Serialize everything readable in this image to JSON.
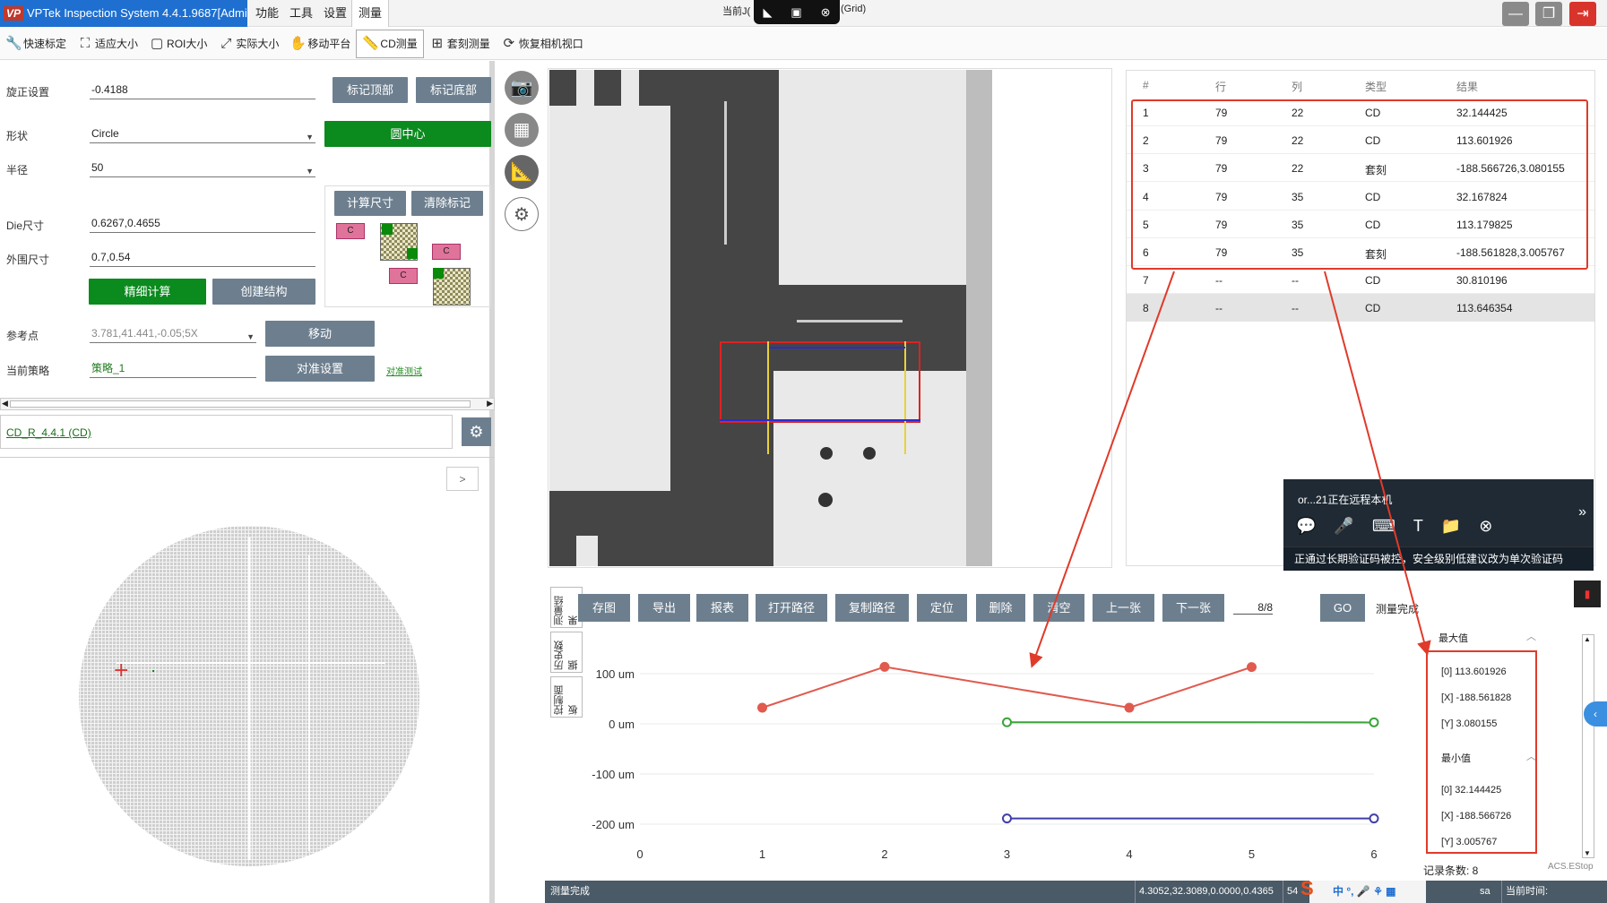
{
  "app": {
    "title": "VPTek Inspection System 4.4.1.9687[Admin]",
    "logo": "VP",
    "menus": [
      "功能",
      "工具",
      "设置",
      "测量"
    ],
    "active_menu": "测量",
    "remote_prefix": "当前J(",
    "remote_grid": "(Grid)"
  },
  "toolbar": [
    {
      "label": "快速标定",
      "icon": "wrench-icon"
    },
    {
      "label": "适应大小",
      "icon": "fit-icon"
    },
    {
      "label": "ROI大小",
      "icon": "roi-icon"
    },
    {
      "label": "实际大小",
      "icon": "expand-icon"
    },
    {
      "label": "移动平台",
      "icon": "hand-icon"
    },
    {
      "label": "CD测量",
      "icon": "ruler-icon"
    },
    {
      "label": "套刻测量",
      "icon": "plus-icon"
    },
    {
      "label": "恢复相机视口",
      "icon": "camera-reset-icon"
    }
  ],
  "left": {
    "rotation_label": "旋正设置",
    "rotation_value": "-0.4188",
    "mark_top": "标记顶部",
    "mark_bottom": "标记底部",
    "shape_label": "形状",
    "shape_value": "Circle",
    "circle_center": "圆中心",
    "radius_label": "半径",
    "radius_value": "50",
    "calc_size": "计算尺寸",
    "clear_mark": "清除标记",
    "tag_c": "C",
    "die_label": "Die尺寸",
    "die_value": "0.6267,0.4655",
    "outer_label": "外围尺寸",
    "outer_value": "0.7,0.54",
    "fine_calc": "精细计算",
    "create_struct": "创建结构",
    "ref_label": "参考点",
    "ref_value": "3.781,41.441,-0.05;5X",
    "move_btn": "移动",
    "strategy_label": "当前策略",
    "strategy_value": "策略_1",
    "align_btn": "对准设置",
    "align_test": "对准测试",
    "recipe_link": "CD_R_4.4.1 (CD)",
    "expand_btn": ">"
  },
  "results": {
    "headers": [
      "#",
      "行",
      "列",
      "类型",
      "结果"
    ],
    "rows": [
      [
        "1",
        "79",
        "22",
        "CD",
        "32.144425"
      ],
      [
        "2",
        "79",
        "22",
        "CD",
        "113.601926"
      ],
      [
        "3",
        "79",
        "22",
        "套刻",
        "-188.566726,3.080155"
      ],
      [
        "4",
        "79",
        "35",
        "CD",
        "32.167824"
      ],
      [
        "5",
        "79",
        "35",
        "CD",
        "113.179825"
      ],
      [
        "6",
        "79",
        "35",
        "套刻",
        "-188.561828,3.005767"
      ],
      [
        "7",
        "--",
        "--",
        "CD",
        "30.810196"
      ],
      [
        "8",
        "--",
        "--",
        "CD",
        "113.646354"
      ]
    ],
    "selected_row": 8
  },
  "remote_popup": {
    "title": "or...21正在远程本机",
    "message": "正通过长期验证码被控，安全级别低建议改为单次验证码"
  },
  "actions": {
    "buttons": [
      "存图",
      "导出",
      "报表",
      "打开路径",
      "复制路径",
      "定位",
      "删除",
      "清空",
      "上一张",
      "下一张"
    ],
    "page": "8/8",
    "go": "GO",
    "status": "测量完成",
    "vertical_tabs": [
      "测量结果",
      "历史数据",
      "控制面板"
    ]
  },
  "stats": {
    "max_title": "最大值",
    "max": [
      "[0]   113.601926",
      "[X]   -188.561828",
      "[Y]   3.080155"
    ],
    "min_title": "最小值",
    "min": [
      "[0]   32.144425",
      "[X]   -188.566726",
      "[Y]   3.005767"
    ],
    "record_count": "记录条数: 8",
    "side_label": "ACS.EStop"
  },
  "chart_data": {
    "type": "line",
    "x": [
      0,
      1,
      2,
      3,
      4,
      5,
      6
    ],
    "ylim": [
      -200,
      100
    ],
    "ytick_labels": [
      "100 um",
      "0 um",
      "-100 um",
      "-200 um"
    ],
    "yticks": [
      100,
      0,
      -100,
      -200
    ],
    "xtick_labels": [
      "0",
      "1",
      "2",
      "3",
      "4",
      "5",
      "6"
    ],
    "series": [
      {
        "color": "#e05a4f",
        "points": [
          [
            1,
            32.14
          ],
          [
            2,
            113.6
          ],
          [
            4,
            32.17
          ],
          [
            5,
            113.18
          ]
        ]
      },
      {
        "color": "#3aa43a",
        "points": [
          [
            3,
            3.08
          ],
          [
            6,
            3.01
          ]
        ]
      },
      {
        "color": "#3f3fa8",
        "points": [
          [
            3,
            -188.57
          ],
          [
            6,
            -188.56
          ]
        ]
      }
    ],
    "grid": true
  },
  "statusbar": {
    "left": "测量完成",
    "coords": "4.3052,32.3089,0.0000,0.4365",
    "extra": "54",
    "ime": "中",
    "user": "sa",
    "time_label": "当前时间:"
  }
}
